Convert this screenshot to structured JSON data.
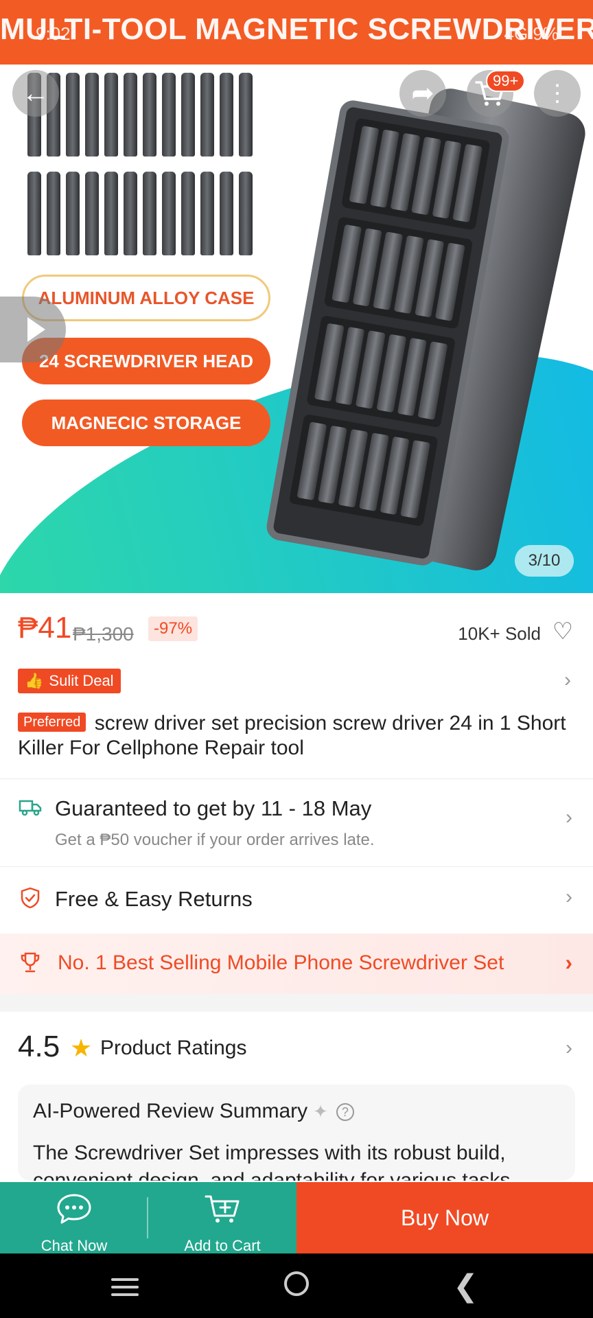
{
  "hero": {
    "banner_text": "MULTI-TOOL MAGNETIC SCREWDRIVER",
    "status_time": "9:02",
    "status_right": "4G  9%",
    "feature_pills": [
      "ALUMINUM ALLOY CASE",
      "24 SCREWDRIVER HEAD",
      "MAGNECIC STORAGE"
    ],
    "cart_badge": "99+",
    "image_counter": "3/10",
    "icons": {
      "back": "back-arrow-icon",
      "share": "share-icon",
      "cart": "cart-icon",
      "more": "more-vertical-icon",
      "play": "play-icon"
    }
  },
  "product": {
    "price_current": "₱41",
    "price_original": "₱1,300",
    "discount": "-97%",
    "sold": "10K+ Sold",
    "sulit_deal": "Sulit Deal",
    "preferred": "Preferred",
    "title": "screw driver set precision screw driver 24 in 1 Short Killer For Cellphone Repair tool"
  },
  "delivery": {
    "title": "Guaranteed to get by 11 - 18 May",
    "subtitle": "Get a ₱50 voucher if your order arrives late."
  },
  "returns": {
    "title": "Free & Easy Returns"
  },
  "bestseller": {
    "text": "No. 1 Best Selling Mobile Phone Screwdriver Set"
  },
  "ratings": {
    "score": "4.5",
    "label": "Product Ratings"
  },
  "ai_summary": {
    "title": "AI-Powered Review Summary",
    "body": "The Screwdriver Set impresses with its robust build, convenient design, and adaptability for various tasks."
  },
  "actions": {
    "chat": "Chat Now",
    "add_to_cart": "Add to Cart",
    "buy_now": "Buy Now"
  },
  "colors": {
    "accent": "#f04a24",
    "teal": "#22a88e",
    "rating_star": "#f7b500"
  }
}
